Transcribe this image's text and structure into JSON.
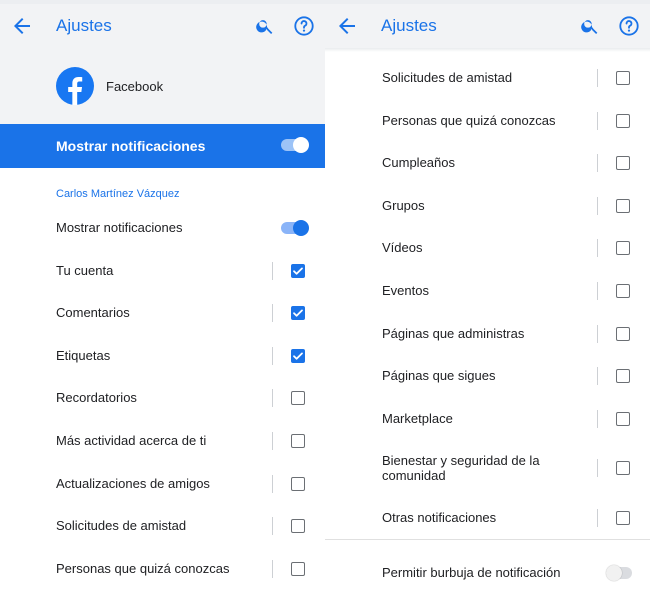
{
  "colors": {
    "accent": "#1a73e8",
    "header_bg": "#f2f3f5",
    "facebook_blue": "#1877f2"
  },
  "left": {
    "appbar": {
      "title": "Ajustes",
      "back_icon": "arrow-left-icon",
      "search_icon": "search-icon",
      "help_icon": "help-circle-icon"
    },
    "app": {
      "name": "Facebook",
      "icon": "facebook-logo-icon"
    },
    "master_toggle": {
      "label": "Mostrar notificaciones",
      "on": true
    },
    "section_title": "Carlos Martínez Vázquez",
    "rows": [
      {
        "label": "Mostrar notificaciones",
        "control": "switch",
        "checked": true
      },
      {
        "label": "Tu cuenta",
        "control": "checkbox",
        "checked": true
      },
      {
        "label": "Comentarios",
        "control": "checkbox",
        "checked": true
      },
      {
        "label": "Etiquetas",
        "control": "checkbox",
        "checked": true
      },
      {
        "label": "Recordatorios",
        "control": "checkbox",
        "checked": false
      },
      {
        "label": "Más actividad acerca de ti",
        "control": "checkbox",
        "checked": false
      },
      {
        "label": "Actualizaciones de amigos",
        "control": "checkbox",
        "checked": false
      },
      {
        "label": "Solicitudes de amistad",
        "control": "checkbox",
        "checked": false
      },
      {
        "label": "Personas que quizá conozcas",
        "control": "checkbox",
        "checked": false
      }
    ]
  },
  "right": {
    "appbar": {
      "title": "Ajustes",
      "back_icon": "arrow-left-icon",
      "search_icon": "search-icon",
      "help_icon": "help-circle-icon"
    },
    "rows": [
      {
        "label": "Solicitudes de amistad",
        "control": "checkbox",
        "checked": false
      },
      {
        "label": "Personas que quizá conozcas",
        "control": "checkbox",
        "checked": false
      },
      {
        "label": "Cumpleaños",
        "control": "checkbox",
        "checked": false
      },
      {
        "label": "Grupos",
        "control": "checkbox",
        "checked": false
      },
      {
        "label": "Vídeos",
        "control": "checkbox",
        "checked": false
      },
      {
        "label": "Eventos",
        "control": "checkbox",
        "checked": false
      },
      {
        "label": "Páginas que administras",
        "control": "checkbox",
        "checked": false
      },
      {
        "label": "Páginas que sigues",
        "control": "checkbox",
        "checked": false
      },
      {
        "label": "Marketplace",
        "control": "checkbox",
        "checked": false
      },
      {
        "label": "Bienestar y seguridad de la comunidad",
        "control": "checkbox",
        "checked": false
      },
      {
        "label": "Otras notificaciones",
        "control": "checkbox",
        "checked": false
      },
      {
        "label": "Permitir burbuja de notificación",
        "control": "switch",
        "checked": false
      }
    ]
  }
}
